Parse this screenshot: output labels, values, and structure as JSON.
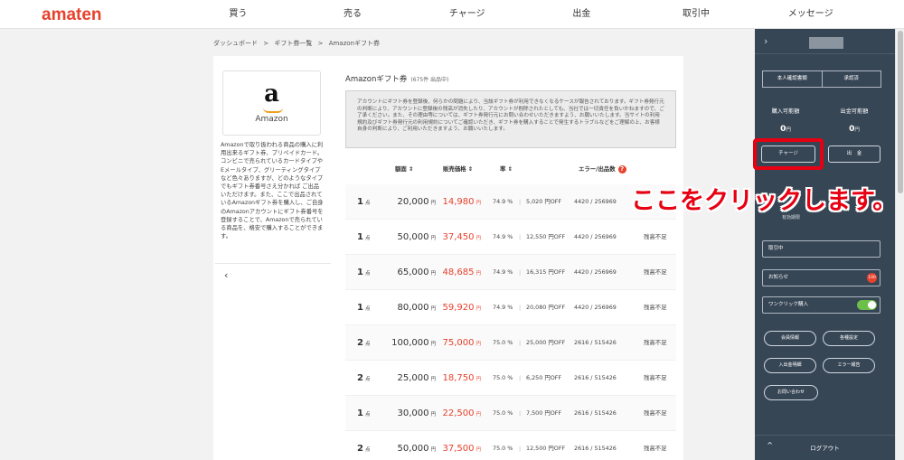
{
  "brand": "amaten",
  "nav": [
    "買う",
    "売る",
    "チャージ",
    "出金",
    "取引中",
    "メッセージ"
  ],
  "breadcrumb": [
    "ダッシュボード",
    ">",
    "ギフト券一覧",
    ">",
    "Amazonギフト券"
  ],
  "gift": {
    "letter": "a",
    "name": "Amazon",
    "description": "Amazonで取り扱われる商品の購入に利用出来るギフト券、プリペイドカード。コンビニで売られているカードタイプやEメールタイプ、グリーティングタイプなど色々ありますが、どのようなタイプでもギフト券番号さえ分かれば ご出品いただけます。また、ここで出品されているAmazonギフト券を購入し、ご自身のAmazonアカウントにギフト券番号を登録することで、Amazonで売られている商品を、格安で購入することができます。"
  },
  "listing": {
    "title": "Amazonギフト券",
    "count": "(675件 出品中)",
    "notice": "アカウントにギフト券を登録後、何らかの問題により、当該ギフト券が利用できなくなるケースが報告されております。ギフト券発行元の判断により、アカウントに登録後の残高が消失したり、アカウントが削除されたとしても、当社では一切責任を負いかねますので、ご了承ください。また、その理由等については、ギフト券発行元にお問い合わせいただきますよう、お願いいたします。当サイトの利用規約及びギフト券発行元の利用規約についてご確認いただき、ギフト券を購入することで発生するトラブルなどをご理解の上、お客様自身の判断により、ご利用いただきますよう、お願いいたします。",
    "headers": {
      "face": "額面",
      "sale": "販売価格",
      "rate": "率",
      "error": "エラー/出品数",
      "sort": "⇕",
      "help": "?"
    },
    "units": {
      "qty": "点",
      "yen": "円"
    },
    "rows": [
      {
        "qty": "1",
        "face": "20,000",
        "sale": "14,980",
        "rate": "74.9 %",
        "off": "5,020 円OFF",
        "err": "4420 / 256969",
        "status": ""
      },
      {
        "qty": "1",
        "face": "50,000",
        "sale": "37,450",
        "rate": "74.9 %",
        "off": "12,550 円OFF",
        "err": "4420 / 256969",
        "status": "残高不足"
      },
      {
        "qty": "1",
        "face": "65,000",
        "sale": "48,685",
        "rate": "74.9 %",
        "off": "16,315 円OFF",
        "err": "4420 / 256969",
        "status": "残高不足"
      },
      {
        "qty": "1",
        "face": "80,000",
        "sale": "59,920",
        "rate": "74.9 %",
        "off": "20,080 円OFF",
        "err": "4420 / 256969",
        "status": "残高不足"
      },
      {
        "qty": "2",
        "face": "100,000",
        "sale": "75,000",
        "rate": "75.0 %",
        "off": "25,000 円OFF",
        "err": "2616 / 515426",
        "status": "残高不足"
      },
      {
        "qty": "2",
        "face": "25,000",
        "sale": "18,750",
        "rate": "75.0 %",
        "off": "6,250 円OFF",
        "err": "2616 / 515426",
        "status": "残高不足"
      },
      {
        "qty": "1",
        "face": "30,000",
        "sale": "22,500",
        "rate": "75.0 %",
        "off": "7,500 円OFF",
        "err": "2616 / 515426",
        "status": "残高不足"
      },
      {
        "qty": "2",
        "face": "50,000",
        "sale": "37,500",
        "rate": "75.0 %",
        "off": "12,500 円OFF",
        "err": "2616 / 515426",
        "status": "残高不足"
      }
    ]
  },
  "side": {
    "tabs": [
      "本人確認書類",
      "承認済"
    ],
    "buy_label": "購入可能額",
    "buy_value": "0",
    "withdraw_label": "出金可能額",
    "withdraw_value": "0",
    "yen": "円",
    "charge_btn": "チャージ",
    "withdraw_btn": "出　金",
    "expiry_label": "有効期限",
    "trading": "取引中",
    "notice": "お知らせ",
    "notice_badge": "100",
    "oneclick": "ワンクリック購入",
    "pills": [
      "会員情報",
      "各種設定",
      "入出金明細",
      "エラー報告",
      "お問い合わせ"
    ],
    "logout": "ログアウト"
  },
  "annotation": "ここをクリックします。",
  "colors": {
    "brand": "#e8412c",
    "sidepanel": "#374655",
    "highlight": "#e60012",
    "toggle_on": "#6cc04a"
  }
}
